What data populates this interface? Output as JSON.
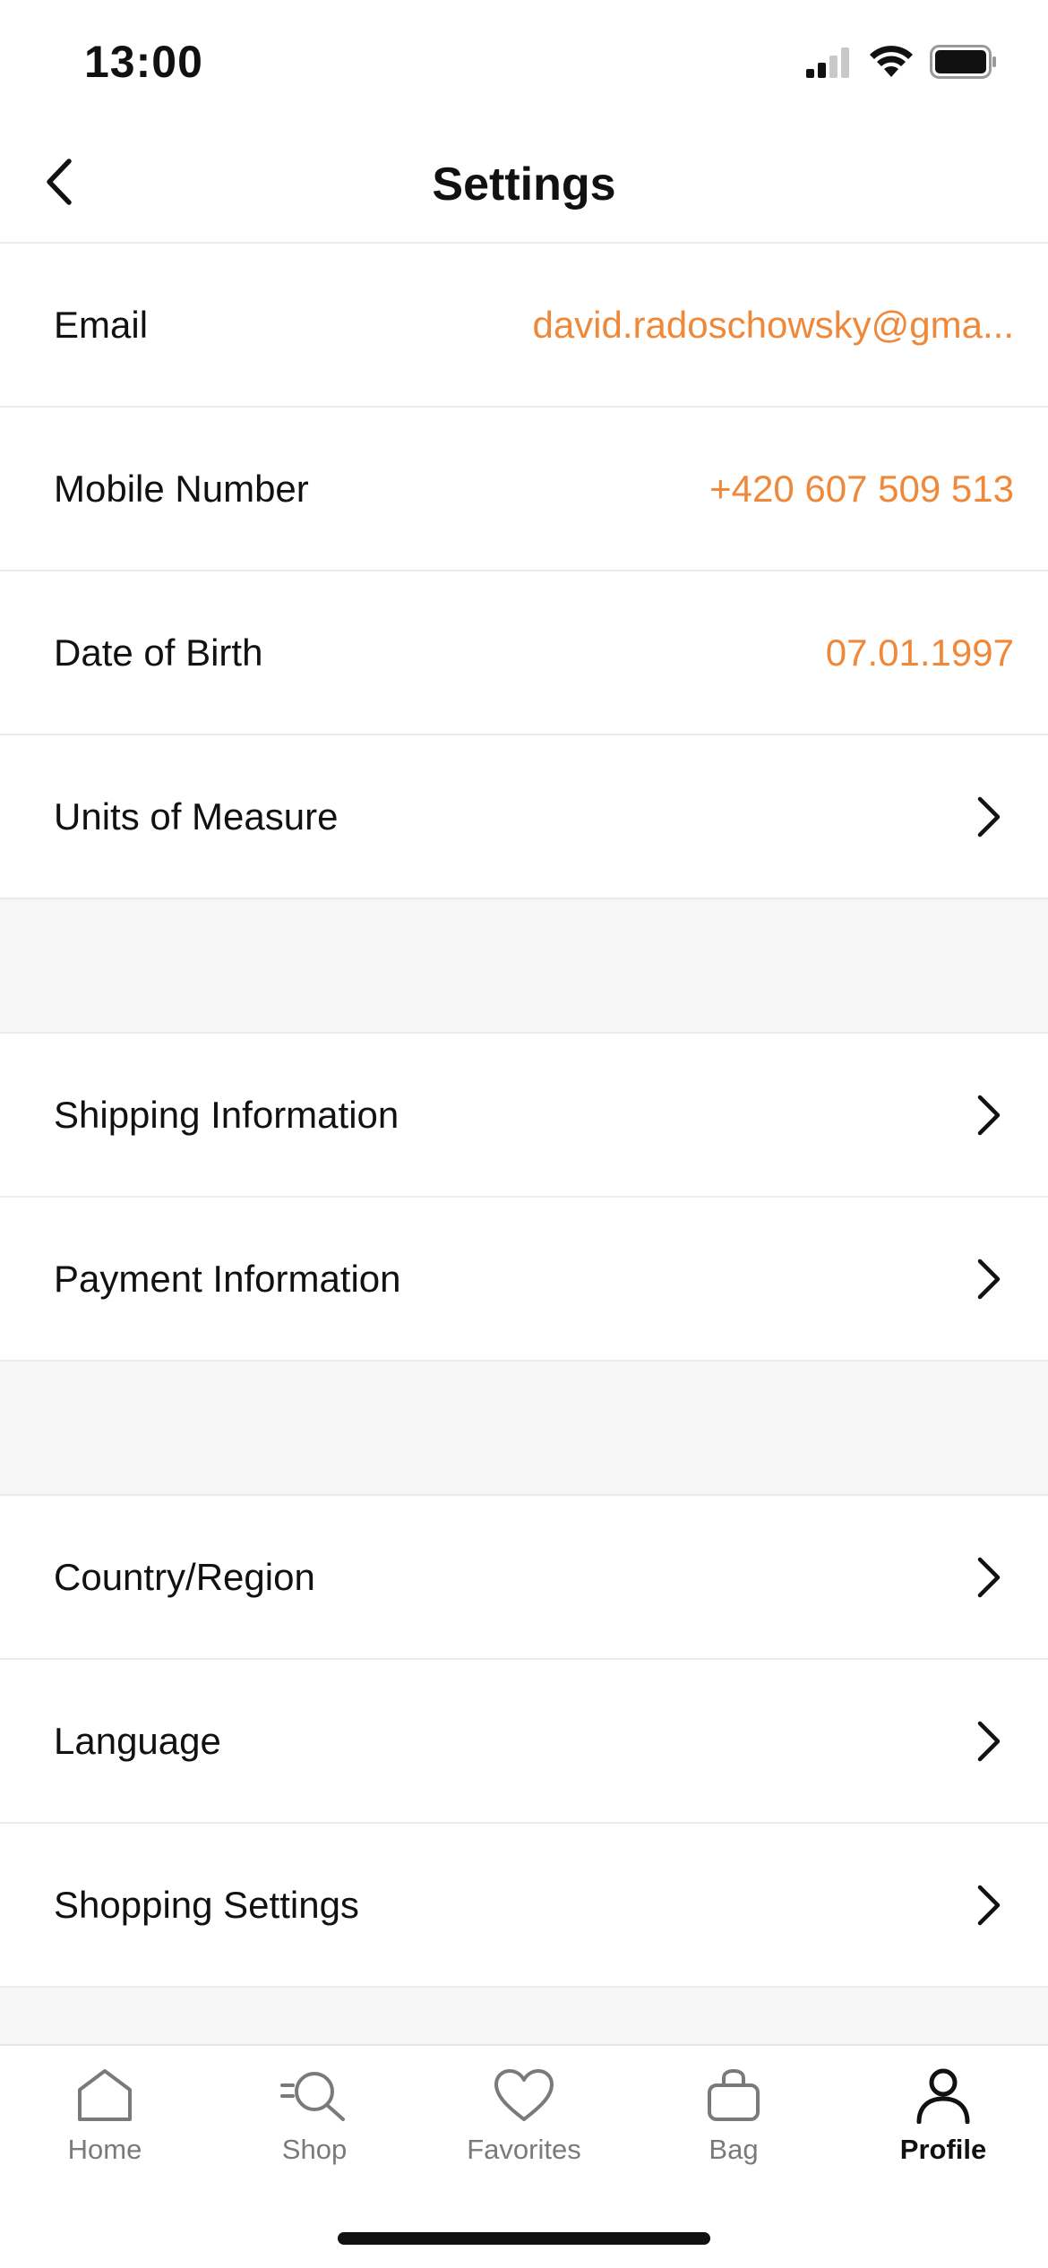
{
  "status_bar": {
    "time": "13:00"
  },
  "header": {
    "title": "Settings",
    "back_icon": "chevron-left-icon"
  },
  "sections": [
    {
      "rows": [
        {
          "label": "Email",
          "value": "david.radoschowsky@gma..."
        },
        {
          "label": "Mobile Number",
          "value": "+420 607 509 513"
        },
        {
          "label": "Date of Birth",
          "value": "07.01.1997"
        },
        {
          "label": "Units of Measure",
          "chevron": true
        }
      ]
    },
    {
      "rows": [
        {
          "label": "Shipping Information",
          "chevron": true
        },
        {
          "label": "Payment Information",
          "chevron": true
        }
      ]
    },
    {
      "rows": [
        {
          "label": "Country/Region",
          "chevron": true
        },
        {
          "label": "Language",
          "chevron": true
        },
        {
          "label": "Shopping Settings",
          "chevron": true
        }
      ]
    }
  ],
  "tab_bar": {
    "tabs": [
      {
        "label": "Home",
        "icon": "home-icon"
      },
      {
        "label": "Shop",
        "icon": "shop-search-icon"
      },
      {
        "label": "Favorites",
        "icon": "heart-icon"
      },
      {
        "label": "Bag",
        "icon": "bag-icon"
      },
      {
        "label": "Profile",
        "icon": "profile-icon",
        "active": true
      }
    ]
  },
  "colors": {
    "accent": "#f0883a",
    "text": "#111111",
    "muted": "#7a7a7a",
    "section_bg": "#f6f6f6",
    "divider": "#ececec"
  }
}
